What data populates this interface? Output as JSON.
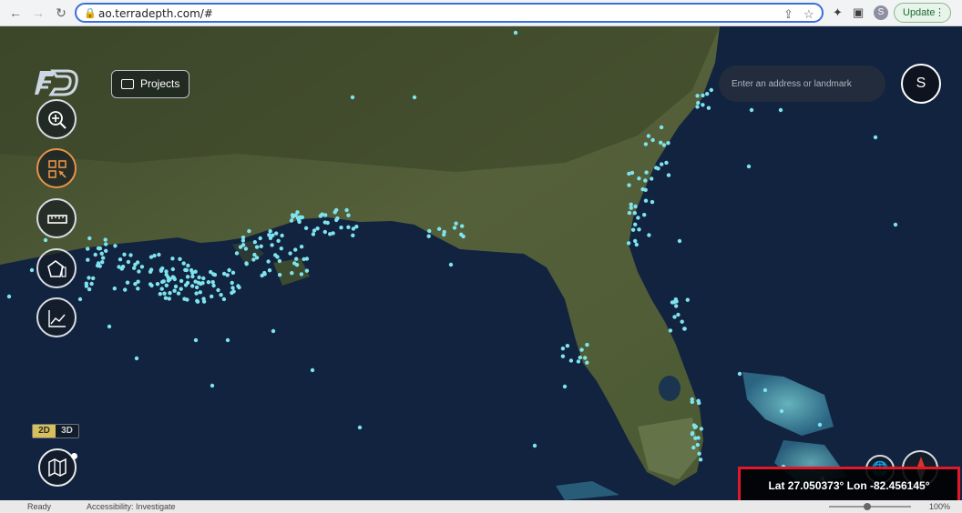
{
  "browser": {
    "url": "ao.terradepth.com/#",
    "profile_initial": "S",
    "update_label": "Update"
  },
  "app": {
    "projects_label": "Projects",
    "search_placeholder": "Enter an address or landmark",
    "user_initial": "S",
    "dimension_2d": "2D",
    "dimension_3d": "3D",
    "dimension_active": "2D",
    "coordinates": "Lat 27.050373° Lon -82.456145°"
  },
  "tools": [
    {
      "name": "zoom-in",
      "icon": "magnifier-plus-icon",
      "active": false
    },
    {
      "name": "select-area",
      "icon": "select-grid-icon",
      "active": true
    },
    {
      "name": "measure",
      "icon": "ruler-icon",
      "active": false
    },
    {
      "name": "polygon-measure",
      "icon": "pentagon-ruler-icon",
      "active": false
    },
    {
      "name": "profile-chart",
      "icon": "line-chart-icon",
      "active": false
    }
  ],
  "status_bar": {
    "ready": "Ready",
    "accessibility": "Accessibility: Investigate",
    "zoom": "100%"
  },
  "colors": {
    "accent_active": "#e8934a",
    "data_points": "#7fe3ee",
    "highlight_border": "#e0182a"
  }
}
